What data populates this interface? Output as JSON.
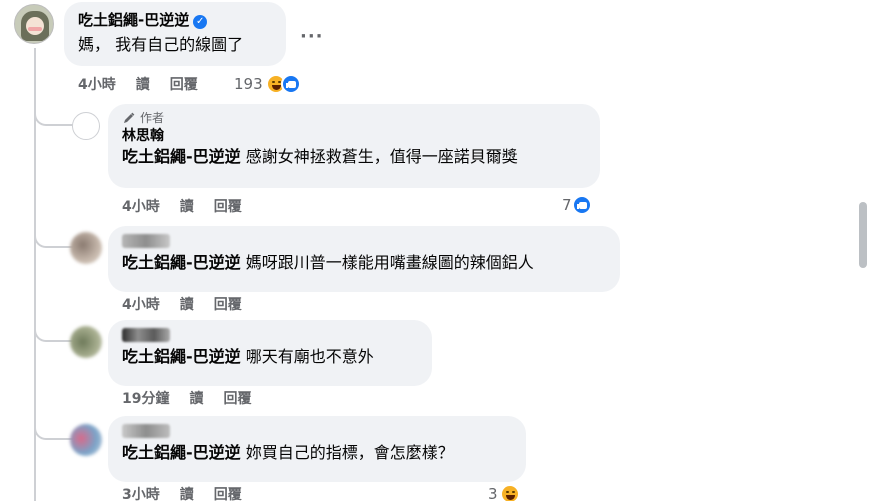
{
  "main_comment": {
    "author": "吃土鋁繩-巴逆逆",
    "text": "媽， 我有自己的線圖了",
    "time": "4小時",
    "read": "讀",
    "reply": "回覆",
    "reaction_count": "193",
    "more": "···"
  },
  "replies": [
    {
      "badge": "作者",
      "author": "林思翰",
      "tag": "吃土鋁繩-巴逆逆",
      "text": "感謝女神拯救蒼生，值得一座諾貝爾獎",
      "time": "4小時",
      "read": "讀",
      "reply": "回覆",
      "reaction_count": "7"
    },
    {
      "tag": "吃土鋁繩-巴逆逆",
      "text": "媽呀跟川普一樣能用嘴畫線圖的辣個鋁人",
      "time": "4小時",
      "read": "讀",
      "reply": "回覆"
    },
    {
      "tag": "吃土鋁繩-巴逆逆",
      "text": "哪天有廟也不意外",
      "time": "19分鐘",
      "read": "讀",
      "reply": "回覆"
    },
    {
      "tag": "吃土鋁繩-巴逆逆",
      "text": "妳買自己的指標，會怎麼樣？",
      "time": "3小時",
      "read": "讀",
      "reply": "回覆",
      "reaction_count": "3"
    }
  ],
  "colors": {
    "link_blue": "#1877f2",
    "bubble": "#f0f2f5",
    "muted": "#65676b"
  }
}
